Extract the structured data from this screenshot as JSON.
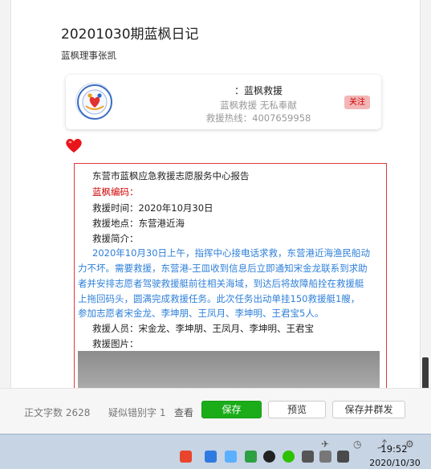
{
  "article": {
    "title": "20201030期蓝枫日记",
    "author": "蓝枫理事张凯"
  },
  "account_card": {
    "name": "：蓝枫救援",
    "slogan": "蓝枫救援  无私奉献",
    "hotline": "救援热线：4007659958",
    "follow_label": "关注"
  },
  "report": {
    "header": "东营市蓝枫应急救援志愿服务中心报告",
    "code_label": "蓝枫编码：",
    "time": "救援时间：2020年10月30日",
    "place": "救援地点：东营港近海",
    "summary_label": "救援简介：",
    "summary_lines": [
      "2020年10月30日上午，指挥中心接电话求救，东营港近海渔民船动",
      "力不坏。需要救援，东营港-王皿收到信息后立即通知宋金龙联系到求助",
      "者并安排志愿者驾驶救援艇前往相关海域，到达后将故障船拴在救援艇",
      "上拖回码头，圆满完成救援任务。此次任务出动单挂150救援艇1艘，",
      "参加志愿者宋金龙、李坤朋、王凤月、李坤明、王君宝5人。"
    ],
    "members": "救援人员：宋金龙、李坤朋、王凤月、李坤明、王君宝",
    "photos_label": "救援图片："
  },
  "bottom_bar": {
    "word_count": "正文字数 2628",
    "typo_count": "疑似错别字 1",
    "view_label": "查看",
    "save_label": "保存",
    "preview_label": "预览",
    "save_publish_label": "保存并群发"
  },
  "taskbar": {
    "time": "19:52",
    "date": "2020/10/30"
  },
  "colors": {
    "accent_green": "#1aad19",
    "report_border": "#e03a3a",
    "summary_blue": "#2e7fd9",
    "code_red": "#d20000"
  }
}
